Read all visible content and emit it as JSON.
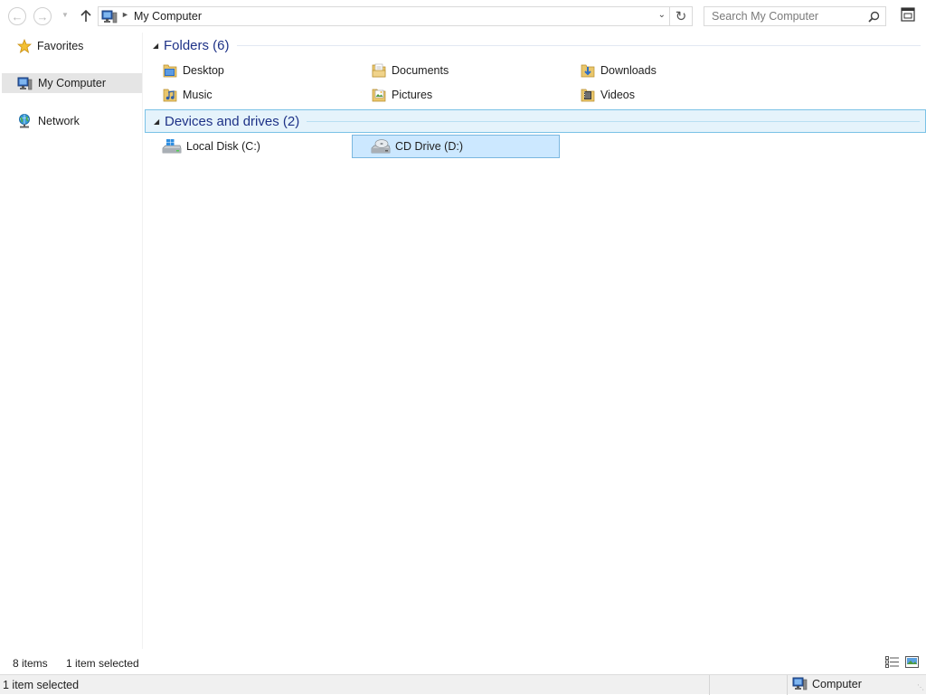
{
  "address_bar": {
    "crumb": "My Computer"
  },
  "search": {
    "placeholder": "Search My Computer"
  },
  "nav_pane": {
    "favorites": "Favorites",
    "my_computer": "My Computer",
    "network": "Network"
  },
  "groups": {
    "folders": {
      "title": "Folders (6)",
      "items": {
        "desktop": "Desktop",
        "documents": "Documents",
        "downloads": "Downloads",
        "music": "Music",
        "pictures": "Pictures",
        "videos": "Videos"
      }
    },
    "devices": {
      "title": "Devices and drives (2)",
      "items": {
        "local_disk": "Local Disk (C:)",
        "cd_drive": "CD Drive (D:)"
      }
    }
  },
  "status": {
    "item_count": "8 items",
    "selection": "1 item selected"
  },
  "bottom_bar": {
    "left": "1 item selected",
    "zone": "Computer"
  },
  "colors": {
    "group_title": "#1e3287",
    "selection_fill": "#cce8ff",
    "selection_border": "#7ab7e0",
    "group_highlight": "#e5f3fb"
  },
  "icons": {
    "back": "back-arrow-icon",
    "forward": "forward-arrow-icon",
    "up": "up-arrow-icon",
    "refresh": "refresh-icon",
    "search": "magnifier-icon",
    "computer": "computer-icon",
    "favorites": "star-icon",
    "network": "network-icon",
    "folder": "folder-icon",
    "local_disk": "hard-drive-icon",
    "cd_drive": "cd-drive-icon"
  }
}
